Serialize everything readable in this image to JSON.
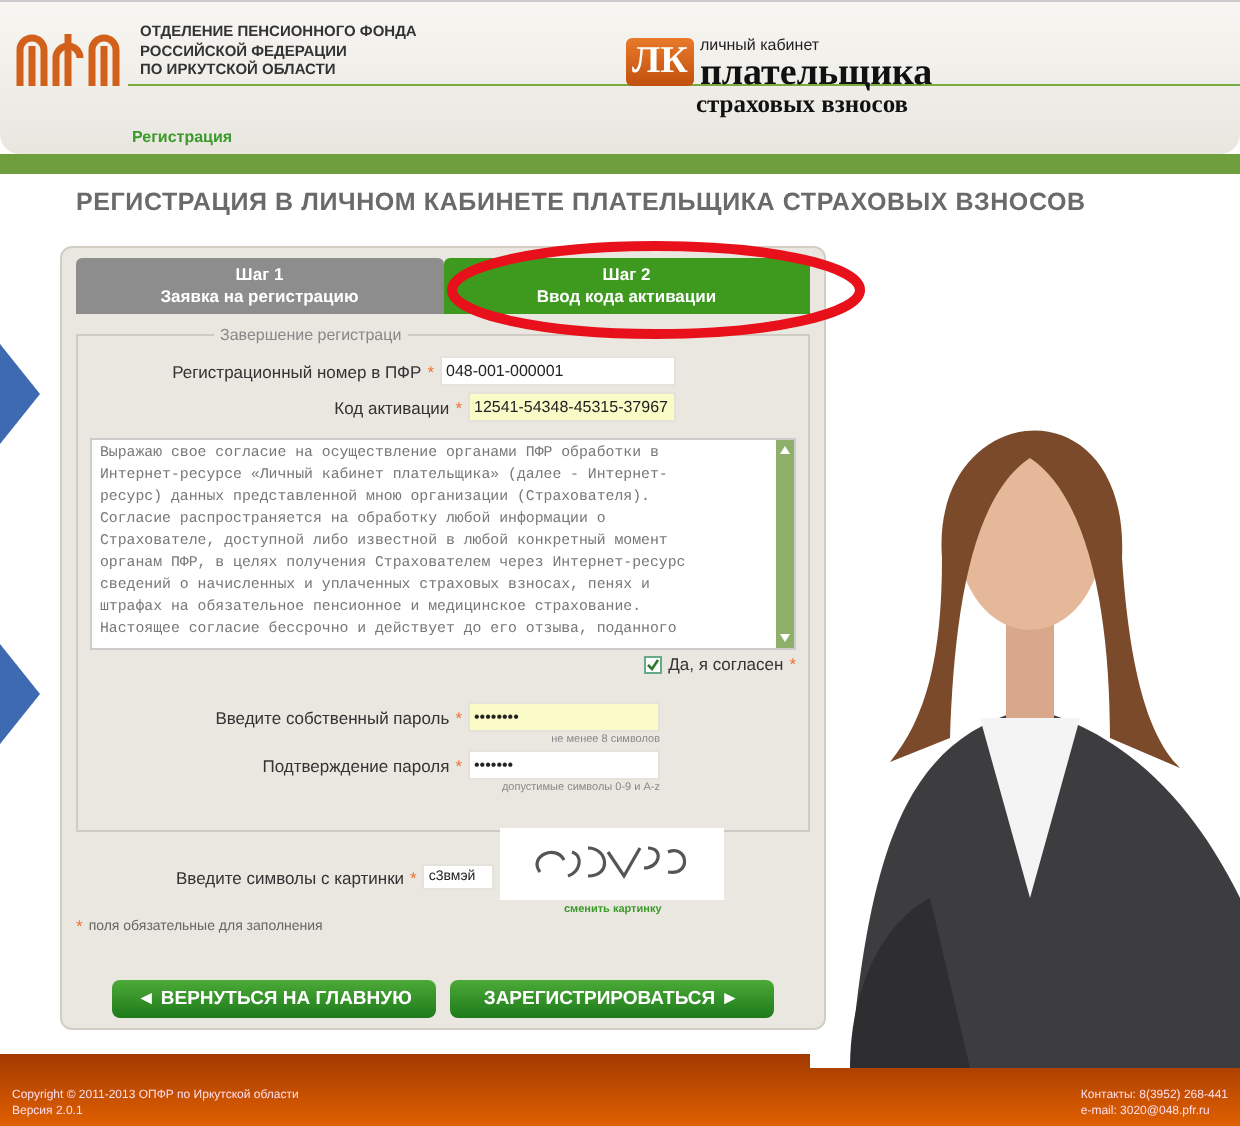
{
  "header": {
    "org_lines": [
      "ОТДЕЛЕНИЕ ПЕНСИОННОГО ФОНДА",
      "РОССИЙСКОЙ ФЕДЕРАЦИИ",
      "ПО ИРКУТСКОЙ ОБЛАСТИ"
    ],
    "logo_badge": "ЛК",
    "logo_small": "личный кабинет",
    "logo_big": "плательщика",
    "logo_sub": "страховых взносов",
    "nav_link": "Регистрация"
  },
  "page_title": "РЕГИСТРАЦИЯ В ЛИЧНОМ КАБИНЕТЕ ПЛАТЕЛЬЩИКА СТРАХОВЫХ ВЗНОСОВ",
  "steps": [
    {
      "step": "Шаг 1",
      "label": "Заявка на регистрацию",
      "selected": false
    },
    {
      "step": "Шаг 2",
      "label": "Ввод кода активации",
      "selected": true
    }
  ],
  "fieldset_legend": "Завершение регистраци",
  "required_mark": "*",
  "fields_top": [
    {
      "label": "Регистрационный номер в ПФР",
      "value": "048-001-000001",
      "highlighted": false,
      "required": true
    },
    {
      "label": "Код активации",
      "value": "12541-54348-45315-37967",
      "highlighted": true,
      "required": true
    }
  ],
  "consent_text": "Выражаю свое согласие на осуществление органами ПФР обработки в\nИнтернет-ресурсе «Личный кабинет плательщика» (далее - Интернет-\nресурс) данных представленной мною организации (Страхователя).\nСогласие распространяется на обработку любой информации о\nСтрахователе, доступной либо известной в любой конкретный момент\nорганам ПФР, в целях получения Страхователем через Интернет-ресурс\nсведений о начисленных и уплаченных страховых взносах, пенях и\nштрафах на обязательное пенсионное и медицинское страхование.\nНастоящее согласие бессрочно и действует до его отзыва, поданного",
  "agree": {
    "label": "Да, я согласен",
    "checked": true,
    "required": true
  },
  "fields_password": [
    {
      "label": "Введите собственный пароль",
      "value": "••••••••",
      "highlighted": true,
      "required": true,
      "hint": "не менее 8 символов"
    },
    {
      "label": "Подтверждение пароля",
      "value": "•••••••",
      "highlighted": false,
      "required": true,
      "hint": "допустимые символы 0-9 и A-z"
    }
  ],
  "captcha": {
    "label": "Введите символы с картинки",
    "value": "c3вмэй",
    "required": true,
    "refresh_link": "сменить картинку"
  },
  "required_note": "поля обязательные для заполнения",
  "buttons": [
    {
      "kind": "back",
      "label": "◄ ВЕРНУТЬСЯ НА ГЛАВНУЮ"
    },
    {
      "kind": "forward",
      "label": "ЗАРЕГИСТРИРОВАТЬСЯ ►"
    }
  ],
  "footer": {
    "copyright": "Copyright © 2011-2013 ОПФР по Иркутской области",
    "version": "Версия 2.0.1",
    "contacts": "Контакты: 8(3952) 268-441",
    "email": "e-mail: 3020@048.pfr.ru"
  }
}
